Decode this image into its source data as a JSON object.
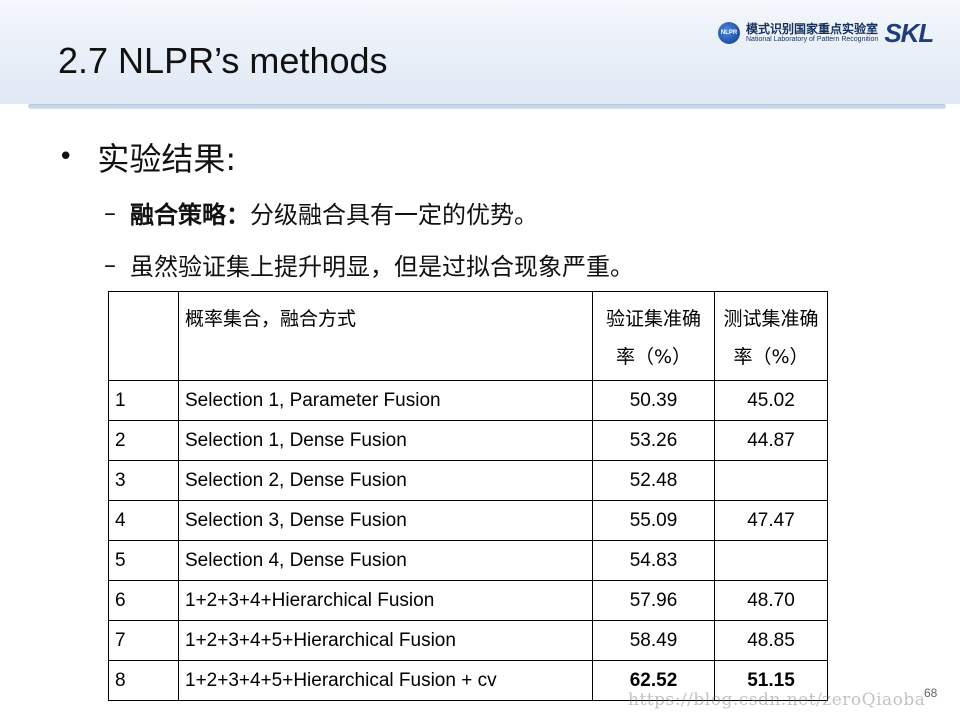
{
  "slide": {
    "title": "2.7 NLPR’s methods",
    "page_number": "68",
    "watermark": "https://blog.csdn.net/zeroQiaoba"
  },
  "logo": {
    "circle_text": "NLPR",
    "cn": "模式识别国家重点实验室",
    "en": "National Laboratory of Pattern Recognition",
    "skl": "SKL"
  },
  "content": {
    "bullet": "实验结果:",
    "sub1_bold": "融合策略：",
    "sub1_rest": "分级融合具有一定的优势。",
    "sub2": "虽然验证集上提升明显，但是过拟合现象严重。"
  },
  "table": {
    "headers": [
      "",
      "概率集合，融合方式",
      "验证集准确率（%）",
      "测试集准确率（%）"
    ],
    "rows": [
      [
        "1",
        "Selection 1, Parameter Fusion",
        "50.39",
        "45.02"
      ],
      [
        "2",
        "Selection 1, Dense Fusion",
        "53.26",
        "44.87"
      ],
      [
        "3",
        "Selection 2, Dense Fusion",
        "52.48",
        ""
      ],
      [
        "4",
        "Selection 3, Dense Fusion",
        "55.09",
        "47.47"
      ],
      [
        "5",
        "Selection 4, Dense Fusion",
        "54.83",
        ""
      ],
      [
        "6",
        "1+2+3+4+Hierarchical Fusion",
        "57.96",
        "48.70"
      ],
      [
        "7",
        "1+2+3+4+5+Hierarchical Fusion",
        "58.49",
        "48.85"
      ],
      [
        "8",
        "1+2+3+4+5+Hierarchical Fusion + cv",
        "62.52",
        "51.15"
      ]
    ]
  }
}
